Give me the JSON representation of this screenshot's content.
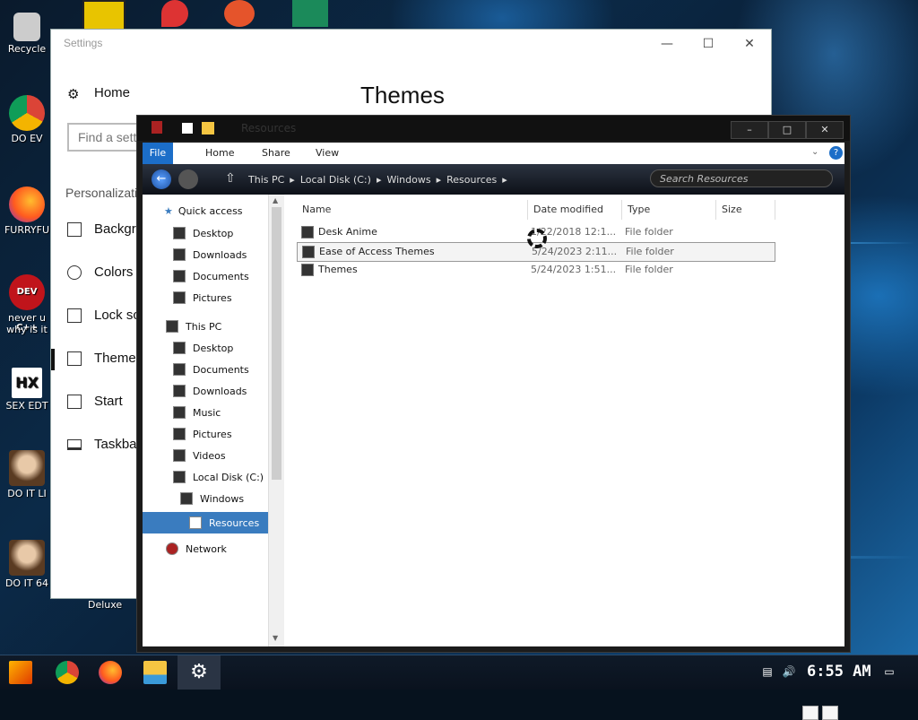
{
  "desktop": {
    "icons": [
      {
        "label": "Recycle",
        "icon": "recycle-bin-icon"
      },
      {
        "label": "DO EV",
        "icon": "chrome-icon"
      },
      {
        "label": "FURRYFU",
        "icon": "firefox-icon"
      },
      {
        "label": "never u",
        "label2": "why is it",
        "icon": "dev-cpp-icon",
        "badge": "DEV C++"
      },
      {
        "label": "SEX EDT",
        "icon": "hxd-icon",
        "badge": "HX"
      },
      {
        "label": "DO IT LI",
        "icon": "portrait-icon"
      },
      {
        "label": "DO IT 64",
        "icon": "portrait-icon"
      }
    ],
    "behind_label": "Deluxe"
  },
  "settings": {
    "title": "Settings",
    "heading": "Themes",
    "search_placeholder": "Find a setting",
    "home_label": "Home",
    "section_label": "Personalization",
    "nav": [
      {
        "label": "Background",
        "icon": "image-icon"
      },
      {
        "label": "Colors",
        "icon": "palette-icon"
      },
      {
        "label": "Lock screen",
        "icon": "lock-screen-icon"
      },
      {
        "label": "Themes",
        "icon": "brush-icon"
      },
      {
        "label": "Start",
        "icon": "start-icon"
      },
      {
        "label": "Taskbar",
        "icon": "taskbar-icon"
      }
    ]
  },
  "explorer": {
    "title": "Resources",
    "ribbon_tabs": [
      "File",
      "Home",
      "Share",
      "View"
    ],
    "breadcrumb": [
      "This PC",
      "Local Disk (C:)",
      "Windows",
      "Resources"
    ],
    "search_placeholder": "Search Resources",
    "nav_quick_access": "Quick access",
    "nav_quick": [
      "Desktop",
      "Downloads",
      "Documents",
      "Pictures"
    ],
    "nav_this_pc": "This PC",
    "nav_pc": [
      "Desktop",
      "Documents",
      "Downloads",
      "Music",
      "Pictures",
      "Videos",
      "Local Disk (C:)",
      "Windows",
      "Resources"
    ],
    "nav_network": "Network",
    "columns": [
      "Name",
      "Date modified",
      "Type",
      "Size"
    ],
    "files": [
      {
        "name": "Desk Anime",
        "date": "1/22/2018 12:1...",
        "type": "File folder"
      },
      {
        "name": "Ease of Access Themes",
        "date": "5/24/2023 2:11...",
        "type": "File folder"
      },
      {
        "name": "Themes",
        "date": "5/24/2023 1:51...",
        "type": "File folder"
      }
    ]
  },
  "taskbar": {
    "clock": "6:55 AM",
    "items": [
      "start-logo-icon",
      "chrome-icon",
      "firefox-icon",
      "file-explorer-icon",
      "settings-gear-icon"
    ]
  }
}
